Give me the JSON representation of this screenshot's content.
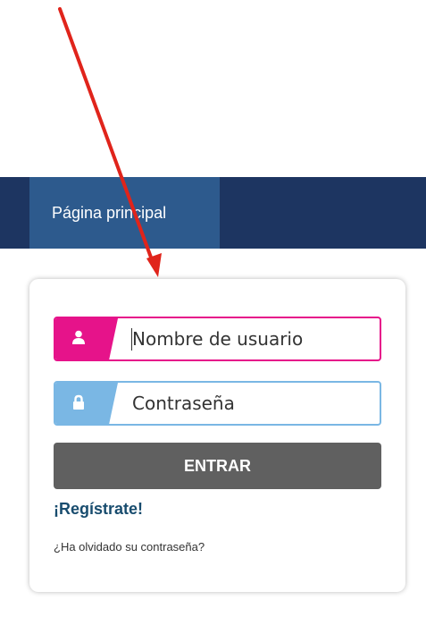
{
  "nav": {
    "tab_label": "Página principal"
  },
  "login": {
    "username_placeholder": "Nombre de usuario",
    "password_placeholder": "Contraseña",
    "submit_label": "ENTRAR",
    "register_label": "¡Regístrate!",
    "forgot_label": "¿Ha olvidado su contraseña?"
  },
  "icons": {
    "username": "user-icon",
    "password": "lock-icon",
    "annotation": "red-arrow"
  },
  "colors": {
    "navbar": "#1d3561",
    "nav_tab": "#2d5a8d",
    "username_accent": "#e6138a",
    "password_accent": "#7ab7e4",
    "submit_button": "#606060",
    "register_link": "#184c6e",
    "annotation_arrow": "#e0241b"
  }
}
